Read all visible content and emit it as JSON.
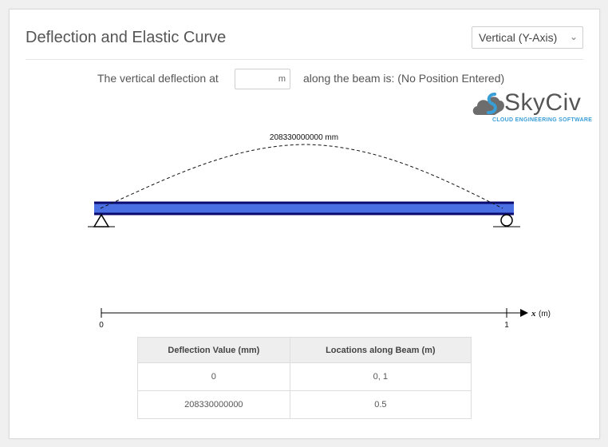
{
  "panel": {
    "title": "Deflection and Elastic Curve",
    "axis_select": {
      "value": "Vertical (Y-Axis)"
    }
  },
  "query": {
    "prefix": "The vertical deflection at",
    "input_value": "",
    "input_unit": "m",
    "suffix": "along the beam is: (No Position Entered)"
  },
  "logo": {
    "name": "SkyCiv",
    "tagline": "CLOUD ENGINEERING SOFTWARE"
  },
  "diagram": {
    "max_deflection_label": "208330000000 mm",
    "axis_start": "0",
    "axis_end": "1",
    "axis_var": "x",
    "axis_unit": "(m)",
    "beam_color": "#4a6fe3",
    "beam_edge_color": "#0a0a6e"
  },
  "table": {
    "headers": [
      "Deflection Value (mm)",
      "Locations along Beam (m)"
    ],
    "rows": [
      [
        "0",
        "0,  1"
      ],
      [
        "208330000000",
        "0.5"
      ]
    ]
  }
}
